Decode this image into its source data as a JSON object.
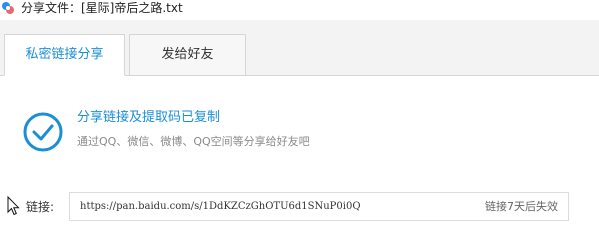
{
  "window": {
    "title": "分享文件：[星际]帝后之路.txt"
  },
  "tabs": [
    {
      "label": "私密链接分享",
      "active": true
    },
    {
      "label": "发给好友",
      "active": false
    }
  ],
  "success": {
    "title": "分享链接及提取码已复制",
    "subtitle": "通过QQ、微信、微博、QQ空间等分享给好友吧"
  },
  "link": {
    "label": "链接:",
    "url": "https://pan.baidu.com/s/1DdKZCzGhOTU6d1SNuP0i0Q",
    "expire": "链接7天后失效"
  },
  "colors": {
    "accent": "#1a8fd6",
    "muted_text": "#8a8a8a",
    "tab_border": "#d6d6d6"
  },
  "icons": {
    "app": "baidu-netdisk-icon",
    "success": "check-circle-icon",
    "cursor": "mouse-pointer-icon"
  }
}
